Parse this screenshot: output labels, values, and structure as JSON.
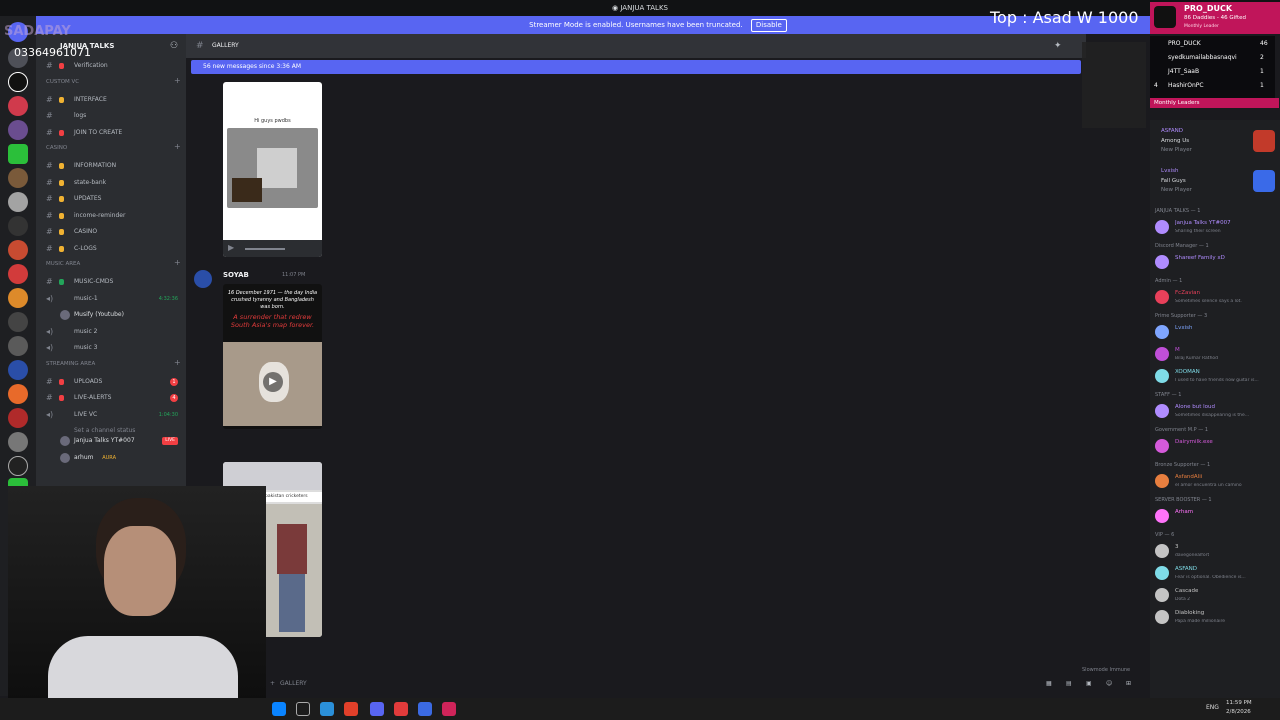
{
  "window": {
    "title": "JANJUA TALKS"
  },
  "banner": {
    "text": "Streamer Mode is enabled. Usernames have been truncated.",
    "button": "Disable"
  },
  "overlay": {
    "watermark": "SADAPAY",
    "phone": "03364961071",
    "top_line": "Top : Asad W 1000",
    "pro_duck": {
      "name": "PRO_DUCK",
      "line2": "86 Daddies - 46 Gifted",
      "line3": "Monthly Leader"
    },
    "leaderboard": [
      {
        "rank": "",
        "name": "PRO_DUCK",
        "count": "46"
      },
      {
        "rank": "",
        "name": "syedkumailabbasnaqvi",
        "count": "2"
      },
      {
        "rank": "",
        "name": "J4TT_SaaB",
        "count": "1"
      },
      {
        "rank": "4",
        "name": "HashirOnPC",
        "count": "1"
      }
    ],
    "leaderboard_footer": "Monthly Leaders"
  },
  "server": {
    "name": "JANJUA TALKS"
  },
  "channels": [
    {
      "type": "channel",
      "name": "Verification",
      "dot": "#f23f43"
    },
    {
      "type": "category",
      "name": "CUSTOM VC"
    },
    {
      "type": "channel",
      "name": "INTERFACE",
      "dot": "#f0b232"
    },
    {
      "type": "channel",
      "name": "logs",
      "dot": ""
    },
    {
      "type": "channel",
      "name": "JOIN TO CREATE",
      "dot": "#f23f43"
    },
    {
      "type": "category",
      "name": "CASINO"
    },
    {
      "type": "channel",
      "name": "INFORMATION",
      "dot": "#f0b232"
    },
    {
      "type": "channel",
      "name": "state-bank",
      "dot": "#f0b232"
    },
    {
      "type": "channel",
      "name": "UPDATES",
      "dot": "#f0b232"
    },
    {
      "type": "channel",
      "name": "income-reminder",
      "dot": "#f0b232"
    },
    {
      "type": "channel",
      "name": "CASINO",
      "dot": "#f0b232"
    },
    {
      "type": "channel",
      "name": "C-LOGS",
      "dot": "#f0b232"
    },
    {
      "type": "category",
      "name": "MUSIC AREA"
    },
    {
      "type": "channel",
      "name": "MUSIC-CMDS",
      "dot": "#23a55a"
    },
    {
      "type": "voice",
      "name": "music-1",
      "extra": "4:32:36"
    },
    {
      "type": "user",
      "name": "Musify (Youtube)"
    },
    {
      "type": "voice",
      "name": "music 2",
      "extra": ""
    },
    {
      "type": "voice",
      "name": "music 3",
      "extra": ""
    },
    {
      "type": "category",
      "name": "STREAMING AREA"
    },
    {
      "type": "channel",
      "name": "UPLOADS",
      "dot": "#f23f43",
      "badge": "1"
    },
    {
      "type": "channel",
      "name": "LIVE-ALERTS",
      "dot": "#f23f43",
      "badge": "4"
    },
    {
      "type": "voice",
      "name": "LIVE VC",
      "extra": "1:04:30"
    },
    {
      "type": "sub",
      "name": "Set a channel status"
    },
    {
      "type": "user",
      "name": "Janjua Talks YT#007",
      "live": "LIVE"
    },
    {
      "type": "user",
      "name": "arhum",
      "extra": "AURA"
    }
  ],
  "header": {
    "channel": "GALLERY"
  },
  "new_messages": "56 new messages since 3:36 AM",
  "messages": {
    "card1_caption": "Hi guys pwdbs",
    "author": "SOYAB",
    "time": "11:07 PM",
    "card2_text": "16 December 1971 — the day India crushed tyranny and Bangladesh was born.",
    "card2_headline": "A surrender that redrew South Asia's map forever.",
    "card3_caption": "pakistan cricketers"
  },
  "composer": {
    "placeholder": "GALLERY",
    "slowmode": "Slowmode Immune"
  },
  "activities": [
    {
      "user": "ASFAND",
      "game": "Among Us",
      "status": "New Player"
    },
    {
      "user": "Lvxish",
      "game": "Fall Guys",
      "status": "New Player"
    }
  ],
  "member_groups": [
    {
      "title": "JANJUA TALKS — 1",
      "members": [
        {
          "name": "Janjua Talks YT#007",
          "status": "Sharing their screen",
          "color": "#b08cff"
        }
      ]
    },
    {
      "title": "Discord Manager — 1",
      "members": [
        {
          "name": "Shareef Family xD",
          "status": "",
          "color": "#b08cff"
        }
      ]
    },
    {
      "title": "Admin — 1",
      "members": [
        {
          "name": "FcZavian",
          "status": "Sometimes silence says a lot.",
          "color": "#e8405a"
        }
      ]
    },
    {
      "title": "Prime Supporter — 3",
      "members": [
        {
          "name": "Lvxish",
          "status": "",
          "color": "#7fa6ff"
        },
        {
          "name": "M",
          "status": "Bilaj Kumar Rathod",
          "color": "#c04fd8"
        },
        {
          "name": "XOOMAN",
          "status": "I used to have friends now guitar is...",
          "color": "#7fdce8"
        }
      ]
    },
    {
      "title": "STAFF — 1",
      "members": [
        {
          "name": "Alone but loud",
          "status": "Sometimes disappearing is the...",
          "color": "#b08cff"
        }
      ]
    },
    {
      "title": "Government M.P — 1",
      "members": [
        {
          "name": "Dairymilk.exe",
          "status": "",
          "color": "#d55adb"
        }
      ]
    },
    {
      "title": "Bronze Supporter — 1",
      "members": [
        {
          "name": "AsfandAlii",
          "status": "el amor encuentra un camino",
          "color": "#e87f3f"
        }
      ]
    },
    {
      "title": "SERVER BOOSTER — 1",
      "members": [
        {
          "name": "Arham",
          "status": "",
          "color": "#ff73fa"
        }
      ]
    },
    {
      "title": "VIP — 6",
      "members": [
        {
          "name": "3",
          "status": "davegonealfort",
          "color": "#c4c4c4"
        },
        {
          "name": "ASFAND",
          "status": "Fear is optional. Obedience is...",
          "color": "#7fdce8"
        },
        {
          "name": "Cascade",
          "status": "Dota 2",
          "color": "#c4c4c4"
        },
        {
          "name": "Diabloking",
          "status": "Papa made millionaire",
          "color": "#c4c4c4"
        }
      ]
    }
  ],
  "taskbar": {
    "lang": "ENG",
    "time": "11:59 PM",
    "date": "2/8/2026"
  },
  "icons": [
    "discord-logo-icon",
    "add-friend-icon",
    "pin-icon",
    "hashtag-icon",
    "plus-icon",
    "settings-icon",
    "speaker-icon",
    "live-icon",
    "search-icon",
    "windows-icon"
  ],
  "colors": {
    "blurple": "#5865f2",
    "live_red": "#f23f43",
    "online_green": "#23a55a"
  }
}
